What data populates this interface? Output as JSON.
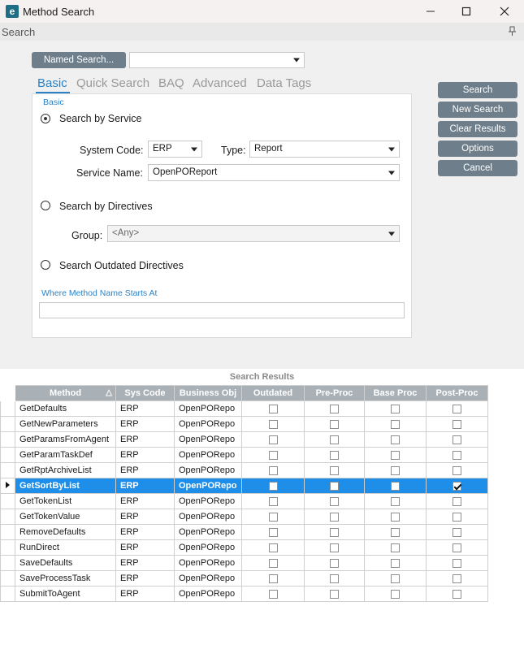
{
  "window": {
    "app_icon": "e",
    "title": "Method Search",
    "minimize_icon": "minimize-icon",
    "maximize_icon": "maximize-icon",
    "close_icon": "close-icon"
  },
  "panel": {
    "header": "Search",
    "pin_icon": "pin-icon"
  },
  "named_search": {
    "button_label": "Named Search...",
    "value": ""
  },
  "tabs": [
    {
      "label": "Basic",
      "active": true
    },
    {
      "label": "Quick Search",
      "active": false
    },
    {
      "label": "BAQ",
      "active": false
    },
    {
      "label": "Advanced",
      "active": false
    },
    {
      "label": "Data Tags",
      "active": false
    }
  ],
  "basic": {
    "section_title": "Basic",
    "search_by_service": {
      "label": "Search by Service",
      "checked": true
    },
    "system_code": {
      "label": "System Code:",
      "value": "ERP"
    },
    "type": {
      "label": "Type:",
      "value": "Report"
    },
    "service_name": {
      "label": "Service Name:",
      "value": "OpenPOReport"
    },
    "search_by_directives": {
      "label": "Search by Directives",
      "checked": false
    },
    "group": {
      "label": "Group:",
      "value": "<Any>"
    },
    "search_outdated": {
      "label": "Search Outdated Directives",
      "checked": false
    },
    "method_name_label": "Where Method Name Starts At",
    "method_name_value": ""
  },
  "actions": {
    "search": "Search",
    "new_search": "New Search",
    "clear_results": "Clear Results",
    "options": "Options",
    "cancel": "Cancel"
  },
  "results": {
    "title": "Search Results",
    "columns": [
      "Method",
      "Sys Code",
      "Business Obj",
      "Outdated",
      "Pre-Proc",
      "Base Proc",
      "Post-Proc"
    ],
    "rows": [
      {
        "method": "GetDefaults",
        "sys_code": "ERP",
        "business_obj": "OpenPORepo",
        "outdated": false,
        "pre": false,
        "base": false,
        "post": false,
        "selected": false
      },
      {
        "method": "GetNewParameters",
        "sys_code": "ERP",
        "business_obj": "OpenPORepo",
        "outdated": false,
        "pre": false,
        "base": false,
        "post": false,
        "selected": false
      },
      {
        "method": "GetParamsFromAgent",
        "sys_code": "ERP",
        "business_obj": "OpenPORepo",
        "outdated": false,
        "pre": false,
        "base": false,
        "post": false,
        "selected": false
      },
      {
        "method": "GetParamTaskDef",
        "sys_code": "ERP",
        "business_obj": "OpenPORepo",
        "outdated": false,
        "pre": false,
        "base": false,
        "post": false,
        "selected": false
      },
      {
        "method": "GetRptArchiveList",
        "sys_code": "ERP",
        "business_obj": "OpenPORepo",
        "outdated": false,
        "pre": false,
        "base": false,
        "post": false,
        "selected": false
      },
      {
        "method": "GetSortByList",
        "sys_code": "ERP",
        "business_obj": "OpenPORepo",
        "outdated": false,
        "pre": false,
        "base": false,
        "post": true,
        "selected": true
      },
      {
        "method": "GetTokenList",
        "sys_code": "ERP",
        "business_obj": "OpenPORepo",
        "outdated": false,
        "pre": false,
        "base": false,
        "post": false,
        "selected": false
      },
      {
        "method": "GetTokenValue",
        "sys_code": "ERP",
        "business_obj": "OpenPORepo",
        "outdated": false,
        "pre": false,
        "base": false,
        "post": false,
        "selected": false
      },
      {
        "method": "RemoveDefaults",
        "sys_code": "ERP",
        "business_obj": "OpenPORepo",
        "outdated": false,
        "pre": false,
        "base": false,
        "post": false,
        "selected": false
      },
      {
        "method": "RunDirect",
        "sys_code": "ERP",
        "business_obj": "OpenPORepo",
        "outdated": false,
        "pre": false,
        "base": false,
        "post": false,
        "selected": false
      },
      {
        "method": "SaveDefaults",
        "sys_code": "ERP",
        "business_obj": "OpenPORepo",
        "outdated": false,
        "pre": false,
        "base": false,
        "post": false,
        "selected": false
      },
      {
        "method": "SaveProcessTask",
        "sys_code": "ERP",
        "business_obj": "OpenPORepo",
        "outdated": false,
        "pre": false,
        "base": false,
        "post": false,
        "selected": false
      },
      {
        "method": "SubmitToAgent",
        "sys_code": "ERP",
        "business_obj": "OpenPORepo",
        "outdated": false,
        "pre": false,
        "base": false,
        "post": false,
        "selected": false
      }
    ]
  },
  "colors": {
    "accent": "#2a83c8",
    "button": "#6e7f8b",
    "selection": "#1f8ee8",
    "header": "#a9b1b7"
  }
}
